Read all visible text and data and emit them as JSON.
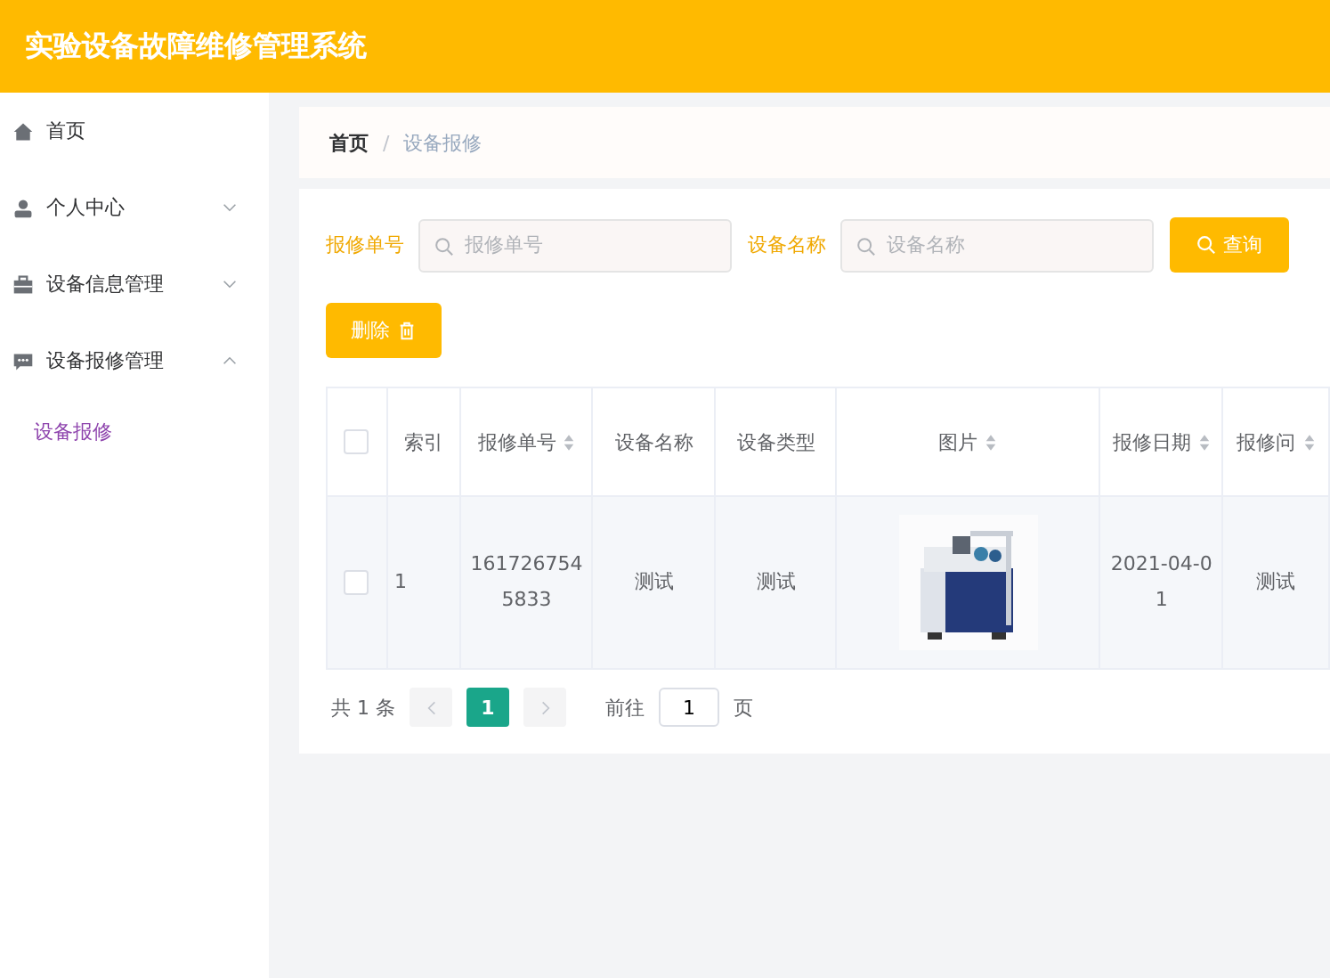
{
  "header": {
    "title": "实验设备故障维修管理系统"
  },
  "sidebar": {
    "items": [
      {
        "label": "首页",
        "kind": "link"
      },
      {
        "label": "个人中心",
        "kind": "menu",
        "expanded": false
      },
      {
        "label": "设备信息管理",
        "kind": "menu",
        "expanded": false
      },
      {
        "label": "设备报修管理",
        "kind": "menu",
        "expanded": true,
        "children": [
          {
            "label": "设备报修",
            "selected": true
          }
        ]
      }
    ]
  },
  "breadcrumb": {
    "items": [
      "首页",
      "设备报修"
    ],
    "separator": "/"
  },
  "search": {
    "fields": [
      {
        "label": "报修单号",
        "placeholder": "报修单号"
      },
      {
        "label": "设备名称",
        "placeholder": "设备名称"
      }
    ],
    "search_button": "查询"
  },
  "delete_button": "删除",
  "table": {
    "header_checked": false,
    "columns": [
      {
        "label": "索引",
        "sortable": false
      },
      {
        "label": "报修单号",
        "sortable": true
      },
      {
        "label": "设备名称",
        "sortable": false
      },
      {
        "label": "设备类型",
        "sortable": false
      },
      {
        "label": "图片",
        "sortable": true
      },
      {
        "label": "报修日期",
        "sortable": true
      },
      {
        "label": "报修问",
        "sortable": true
      }
    ],
    "rows": [
      {
        "checked": false,
        "cells": [
          "1",
          "1617267545833",
          "测试",
          "测试",
          {
            "kind": "picture"
          },
          "2021-04-01",
          "测试"
        ]
      }
    ]
  },
  "pagination": {
    "total": "共 1 条",
    "pages": [
      {
        "label": "1",
        "selected": true
      }
    ],
    "goto_label": "前往",
    "goto_value": "1",
    "page_suffix": "页"
  }
}
